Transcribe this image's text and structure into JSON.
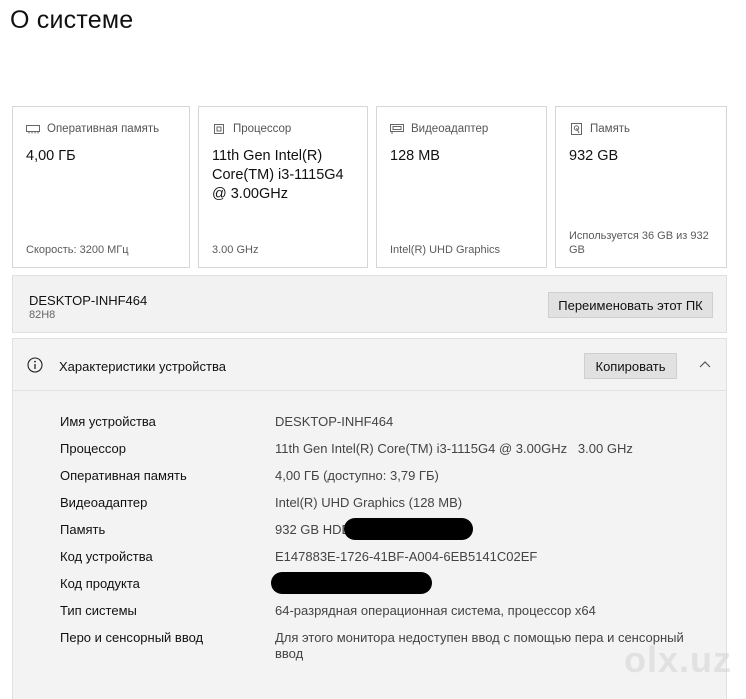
{
  "page": {
    "title": "О системе"
  },
  "cards": [
    {
      "label": "Оперативная память",
      "value": "4,00 ГБ",
      "sub": "Скорость: 3200 МГц",
      "icon": "ram-icon"
    },
    {
      "label": "Процессор",
      "value": "11th Gen Intel(R) Core(TM) i3-1115G4 @ 3.00GHz",
      "sub": "3.00 GHz",
      "icon": "cpu-icon"
    },
    {
      "label": "Видеоадаптер",
      "value": "128 MB",
      "sub": "Intel(R) UHD Graphics",
      "icon": "gpu-icon"
    },
    {
      "label": "Память",
      "value": "932 GB",
      "sub": "Используется 36 GB из 932 GB",
      "icon": "storage-icon"
    }
  ],
  "device": {
    "name": "DESKTOP-INHF464",
    "model": "82H8",
    "rename_label": "Переименовать этот ПК"
  },
  "specs": {
    "title": "Характеристики устройства",
    "copy_label": "Копировать",
    "rows": [
      {
        "label": "Имя устройства",
        "value": "DESKTOP-INHF464"
      },
      {
        "label": "Процессор",
        "value": "11th Gen Intel(R) Core(TM) i3-1115G4 @ 3.00GHz   3.00 GHz"
      },
      {
        "label": "Оперативная память",
        "value": "4,00 ГБ (доступно: 3,79 ГБ)"
      },
      {
        "label": "Видеоадаптер",
        "value": "Intel(R) UHD Graphics (128 MB)"
      },
      {
        "label": "Память",
        "value": "932 GB HDD"
      },
      {
        "label": "Код устройства",
        "value": "E147883E-1726-41BF-A004-6EB5141C02EF"
      },
      {
        "label": "Код продукта",
        "value": ""
      },
      {
        "label": "Тип системы",
        "value": "64-разрядная операционная система, процессор x64"
      },
      {
        "label": "Перо и сенсорный ввод",
        "value": "Для этого монитора недоступен ввод с помощью пера и сенсорный ввод"
      }
    ]
  },
  "watermark": "olx.uz"
}
